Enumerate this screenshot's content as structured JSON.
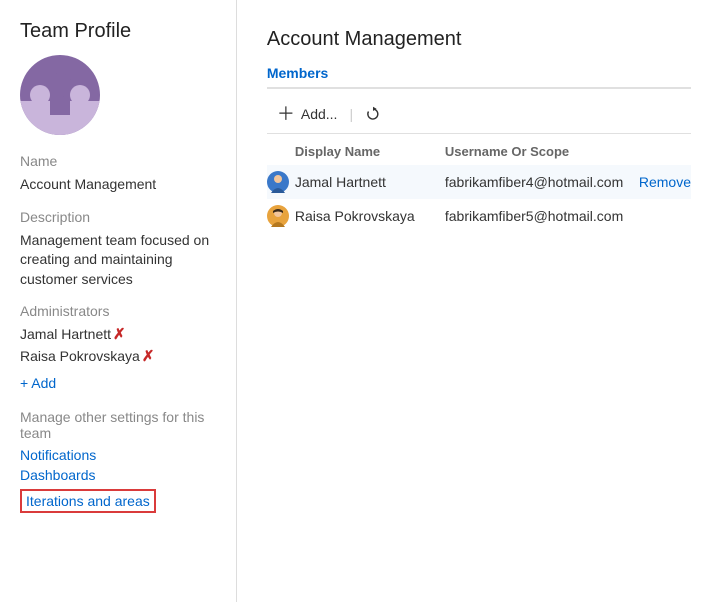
{
  "sidebar": {
    "title": "Team Profile",
    "name_label": "Name",
    "name_value": "Account Management",
    "description_label": "Description",
    "description_value": "Management team focused on creating and maintaining customer services",
    "administrators_label": "Administrators",
    "administrators": [
      {
        "name": "Jamal Hartnett"
      },
      {
        "name": "Raisa Pokrovskaya"
      }
    ],
    "add_admin_label": "+ Add",
    "manage_label": "Manage other settings for this team",
    "links": {
      "notifications": "Notifications",
      "dashboards": "Dashboards",
      "iterations": "Iterations and areas"
    }
  },
  "main": {
    "title": "Account Management",
    "tab_members": "Members",
    "toolbar": {
      "add_label": "Add..."
    },
    "columns": {
      "display_name": "Display Name",
      "username": "Username Or Scope"
    },
    "rows": [
      {
        "name": "Jamal Hartnett",
        "username": "fabrikamfiber4@hotmail.com",
        "action": "Remove",
        "avatar_bg": "#3a78c9",
        "hover": true
      },
      {
        "name": "Raisa Pokrovskaya",
        "username": "fabrikamfiber5@hotmail.com",
        "action": "",
        "avatar_bg": "#e8a33d",
        "hover": false
      }
    ]
  }
}
